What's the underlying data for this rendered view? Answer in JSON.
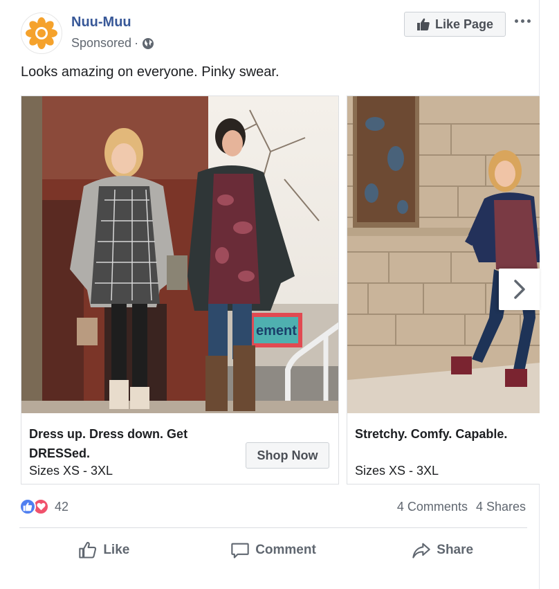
{
  "post": {
    "page_name": "Nuu-Muu",
    "sponsored_label": "Sponsored",
    "meta_separator": "·",
    "like_page_label": "Like Page",
    "message": "Looks amazing on everyone. Pinky swear."
  },
  "carousel": {
    "cards": [
      {
        "title": "Dress up. Dress down. Get DRESSed.",
        "description": "Sizes XS - 3XL",
        "cta_label": "Shop Now",
        "sign_text": "ement"
      },
      {
        "title": "Stretchy. Comfy. Capable.",
        "description": "Sizes XS - 3XL"
      }
    ]
  },
  "reactions": {
    "count": "42",
    "types": [
      "like",
      "love"
    ]
  },
  "engagement": {
    "comments": "4 Comments",
    "shares": "4 Shares"
  },
  "actions": {
    "like": "Like",
    "comment": "Comment",
    "share": "Share"
  },
  "colors": {
    "brand_blue": "#385898",
    "logo_orange": "#f5a22c",
    "like_blue": "#4f7ff0",
    "love_red": "#f0526c",
    "muted_text": "#606770"
  },
  "icons": [
    "flower-logo-icon",
    "globe-icon",
    "thumbs-up-icon",
    "more-dots-icon",
    "chevron-right-icon",
    "like-reaction-icon",
    "love-reaction-icon",
    "comment-icon",
    "share-icon"
  ]
}
